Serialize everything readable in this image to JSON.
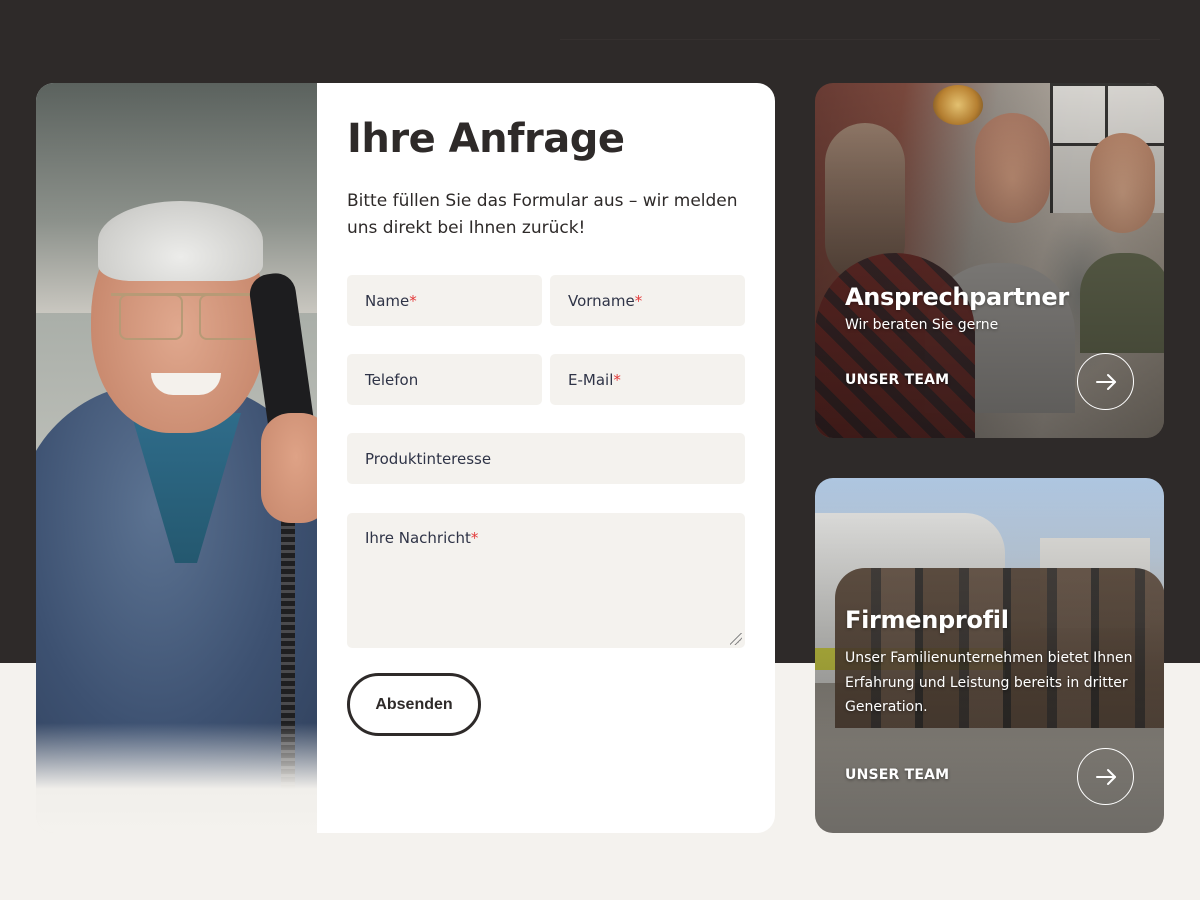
{
  "form": {
    "title": "Ihre Anfrage",
    "intro": "Bitte füllen Sie das Formular aus – wir melden uns direkt bei Ihnen zurück!",
    "fields": {
      "name": {
        "label": "Name",
        "required_mark": "*"
      },
      "vorname": {
        "label": "Vorname",
        "required_mark": "*"
      },
      "telefon": {
        "label": "Telefon"
      },
      "email": {
        "label": "E-Mail",
        "required_mark": "*"
      },
      "produktinteresse": {
        "label": "Produktinteresse"
      },
      "nachricht": {
        "label": "Ihre Nachricht",
        "required_mark": "*"
      }
    },
    "submit_label": "Absenden"
  },
  "cards": [
    {
      "title": "Ansprechpartner",
      "subtitle": "Wir beraten Sie gerne",
      "link_label": "UNSER TEAM",
      "icon": "arrow-right-icon"
    },
    {
      "title": "Firmenprofil",
      "subtitle": "Unser Familienunternehmen bietet Ihnen Erfahrung und Leistung bereits in dritter Generation.",
      "link_label": "UNSER TEAM",
      "icon": "arrow-right-icon"
    }
  ],
  "colors": {
    "dark_background": "#2e2a29",
    "light_background": "#f4f2ee",
    "field_background": "#f4f2ee",
    "required_mark": "#e33a3a",
    "text": "#2e2a29"
  }
}
